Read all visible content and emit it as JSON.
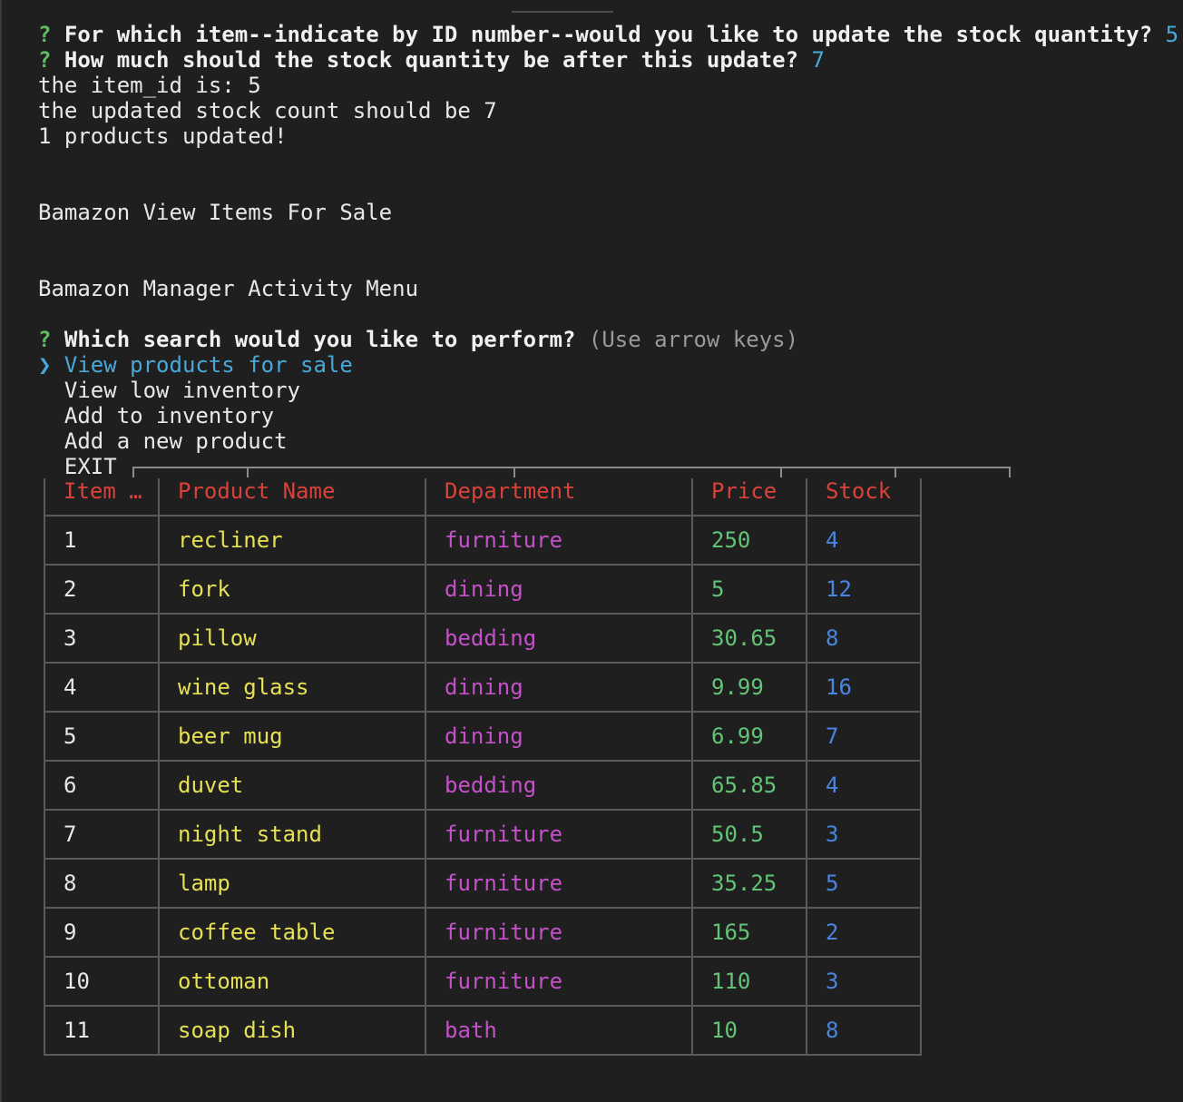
{
  "prompts": {
    "q1_text": "For which item--indicate by ID number--would you like to update the stock quantity?",
    "q1_answer": "5",
    "q2_text": "How much should the stock quantity be after this update?",
    "q2_answer": "7",
    "mark": "?"
  },
  "output": {
    "line1": "the item_id is: 5",
    "line2": "the updated stock count should be 7",
    "line3": "1 products updated!",
    "view_title": "Bamazon View Items For Sale",
    "menu_title": "Bamazon Manager Activity Menu"
  },
  "menu": {
    "question": "Which search would you like to perform?",
    "hint": "(Use arrow keys)",
    "pointer": "❯",
    "options": [
      "View products for sale",
      "View low inventory",
      "Add to inventory",
      "Add a new product",
      "EXIT"
    ]
  },
  "table": {
    "headers": [
      "Item …",
      "Product Name",
      "Department",
      "Price",
      "Stock"
    ],
    "rows": [
      [
        "1",
        "recliner",
        "furniture",
        "250",
        "4"
      ],
      [
        "2",
        "fork",
        "dining",
        "5",
        "12"
      ],
      [
        "3",
        "pillow",
        "bedding",
        "30.65",
        "8"
      ],
      [
        "4",
        "wine glass",
        "dining",
        "9.99",
        "16"
      ],
      [
        "5",
        "beer mug",
        "dining",
        "6.99",
        "7"
      ],
      [
        "6",
        "duvet",
        "bedding",
        "65.85",
        "4"
      ],
      [
        "7",
        "night stand",
        "furniture",
        "50.5",
        "3"
      ],
      [
        "8",
        "lamp",
        "furniture",
        "35.25",
        "5"
      ],
      [
        "9",
        "coffee table",
        "furniture",
        "165",
        "2"
      ],
      [
        "10",
        "ottoman",
        "furniture",
        "110",
        "3"
      ],
      [
        "11",
        "soap dish",
        "bath",
        "10",
        "8"
      ]
    ]
  },
  "colors": {
    "background": "#1f1f1f",
    "prompt_mark": "#5dbb63",
    "answer": "#49a8d8",
    "header": "#d9423a",
    "name": "#e6e055",
    "department": "#c451c9",
    "price": "#62c476",
    "stock": "#4a86e0"
  }
}
